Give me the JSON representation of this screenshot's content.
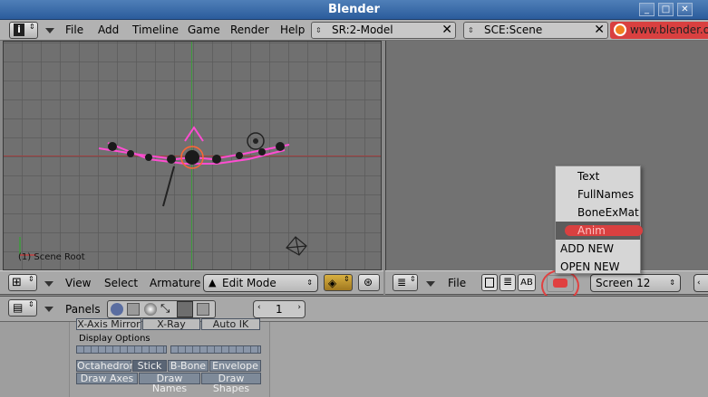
{
  "window": {
    "title": "Blender",
    "controls": [
      "_",
      "□",
      "✕"
    ]
  },
  "menubar": {
    "menus": [
      "File",
      "Add",
      "Timeline",
      "Game",
      "Render",
      "Help"
    ],
    "screen_field": "SR:2-Model",
    "scene_field": "SCE:Scene",
    "url_text": "www.blender.o"
  },
  "view3d": {
    "label": "(1) Scene Root"
  },
  "view3d_header": {
    "menus": [
      "View",
      "Select",
      "Armature"
    ],
    "mode": "Edit Mode"
  },
  "right_header": {
    "file_label": "File",
    "ab_label": "AB",
    "screen_select": "Screen 12"
  },
  "popup_menu": {
    "items": [
      "Text",
      "FullNames",
      "BoneExMat",
      "Anim",
      "ADD NEW",
      "OPEN NEW"
    ],
    "selected": "Anim"
  },
  "buttons_window": {
    "panels_label": "Panels",
    "frame_value": "1",
    "row_top": [
      "X-Axis Mirror",
      "X-Ray",
      "Auto IK"
    ],
    "display_options_label": "Display Options",
    "draw_types": [
      "Octahedron",
      "Stick",
      "B-Bone",
      "Envelope"
    ],
    "draw_toggles": [
      "Draw Axes",
      "Draw Names",
      "Draw Shapes"
    ]
  },
  "colors": {
    "titlebar": "#2b5c9c",
    "highlight": "#d94040",
    "pink": "#ff4dd2"
  }
}
